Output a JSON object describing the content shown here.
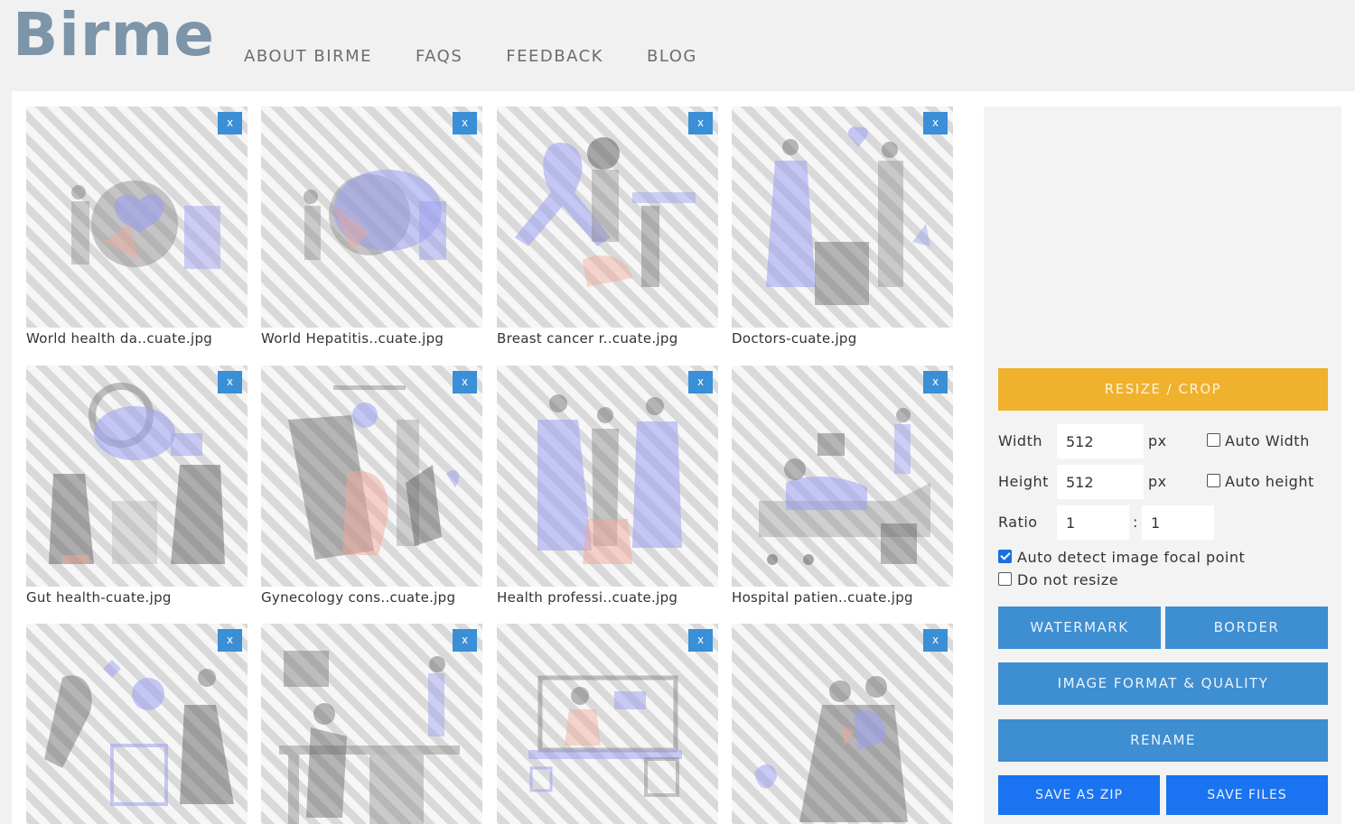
{
  "brand": {
    "logo": "Birme"
  },
  "nav": [
    "ABOUT BIRME",
    "FAQS",
    "FEEDBACK",
    "BLOG"
  ],
  "thumbnails": [
    {
      "name": "World health da..cuate.jpg",
      "remove": "x"
    },
    {
      "name": "World Hepatitis..cuate.jpg",
      "remove": "x"
    },
    {
      "name": "Breast cancer r..cuate.jpg",
      "remove": "x"
    },
    {
      "name": "Doctors-cuate.jpg",
      "remove": "x"
    },
    {
      "name": "Gut health-cuate.jpg",
      "remove": "x"
    },
    {
      "name": "Gynecology cons..cuate.jpg",
      "remove": "x"
    },
    {
      "name": "Health professi..cuate.jpg",
      "remove": "x"
    },
    {
      "name": "Hospital patien..cuate.jpg",
      "remove": "x"
    },
    {
      "name": "",
      "remove": "x"
    },
    {
      "name": "",
      "remove": "x"
    },
    {
      "name": "",
      "remove": "x"
    },
    {
      "name": "",
      "remove": "x"
    }
  ],
  "settings": {
    "resize_button": "RESIZE / CROP",
    "width_label": "Width",
    "width_value": "512",
    "height_label": "Height",
    "height_value": "512",
    "unit": "px",
    "auto_width_label": "Auto Width",
    "auto_height_label": "Auto height",
    "ratio_label": "Ratio",
    "ratio_w": "1",
    "ratio_sep": ":",
    "ratio_h": "1",
    "focal_label": "Auto detect image focal point",
    "no_resize_label": "Do not resize",
    "watermark_button": "WATERMARK",
    "border_button": "BORDER",
    "format_button": "IMAGE FORMAT & QUALITY",
    "rename_button": "RENAME",
    "zip_button": "SAVE AS ZIP",
    "files_button": "SAVE FILES"
  },
  "colors": {
    "accent_orange": "#f0b12c",
    "accent_blue": "#3e8ed2",
    "save_blue": "#1a73f0",
    "logo": "#7d95a9"
  },
  "icons": {
    "remove": "close-icon",
    "checked": "checkmark-icon"
  }
}
